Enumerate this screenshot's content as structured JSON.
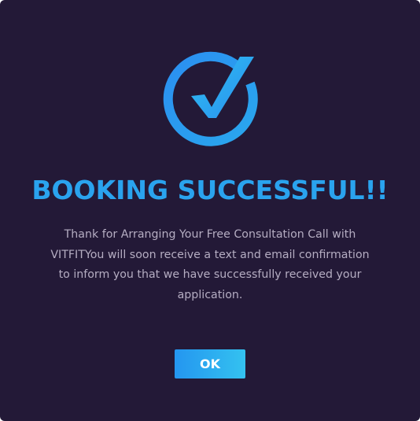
{
  "dialog": {
    "icon": "check-circle-icon",
    "title": "BOOKING SUCCESSFUL!!",
    "message": "Thank for Arranging Your Free Consultation Call with VITFITYou will soon receive a text and email confirmation to inform you that we have successfully received your application.",
    "ok_label": "OK"
  },
  "colors": {
    "background": "#231937",
    "accent": "#2aa3ee",
    "accent_gradient_end": "#34c2f0",
    "message_text": "#b5adc2"
  }
}
